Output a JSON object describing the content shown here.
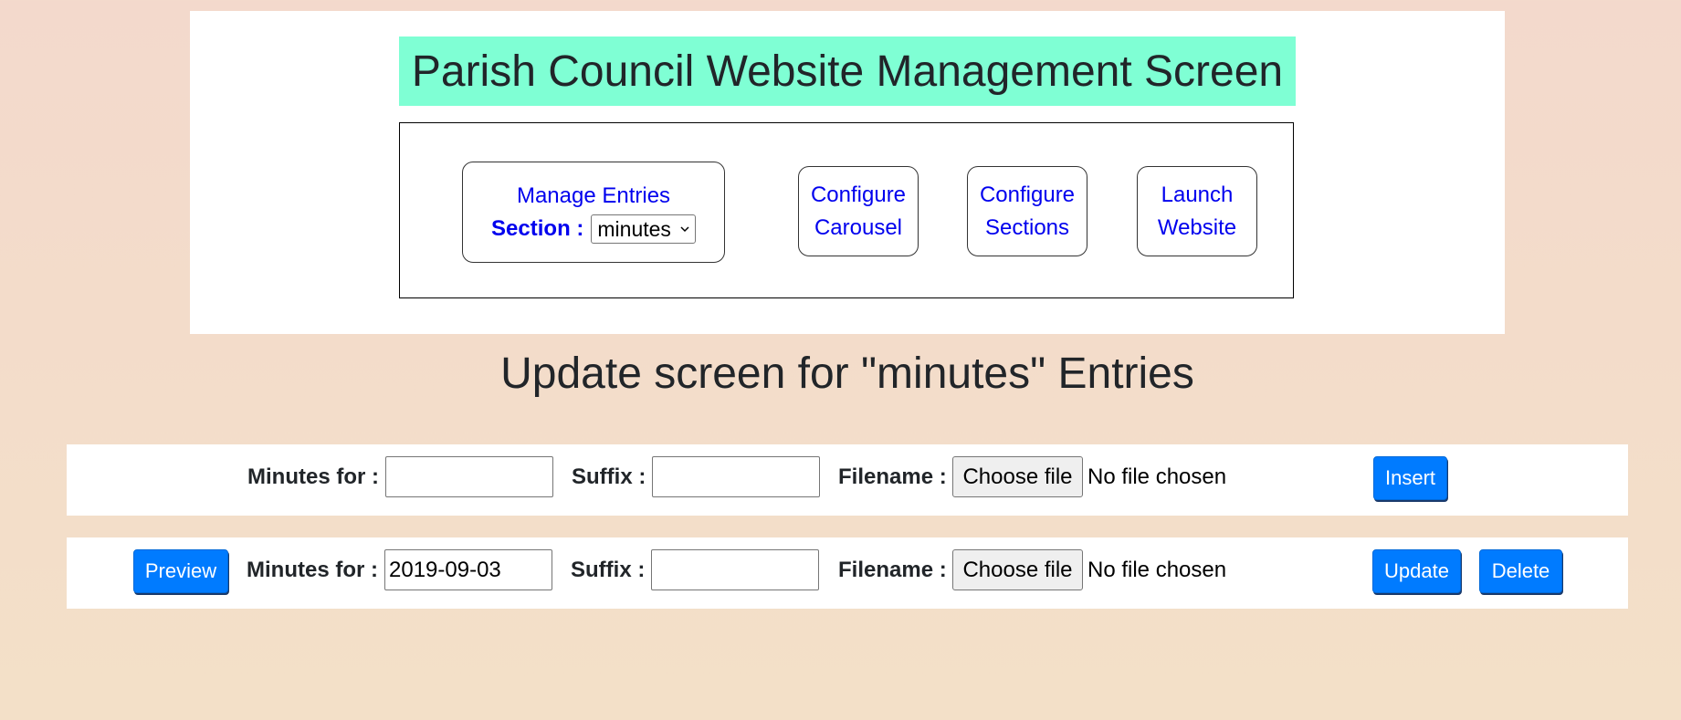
{
  "header": {
    "title": "Parish Council Website Management Screen",
    "nav": {
      "manage_entries": "Manage Entries",
      "section_label": "Section :",
      "section_selected": "minutes",
      "configure_carousel": [
        "Configure",
        "Carousel"
      ],
      "configure_sections": [
        "Configure",
        "Sections"
      ],
      "launch_website": [
        "Launch",
        "Website"
      ]
    }
  },
  "main": {
    "heading": "Update screen for \"minutes\" Entries",
    "insert_row": {
      "minutes_label": "Minutes for :",
      "minutes_value": "",
      "suffix_label": "Suffix :",
      "suffix_value": "",
      "filename_label": "Filename :",
      "file_button": "Choose file",
      "file_status": "No file chosen",
      "insert_button": "Insert"
    },
    "entries": [
      {
        "preview_button": "Preview",
        "minutes_label": "Minutes for :",
        "minutes_value": "2019-09-03",
        "suffix_label": "Suffix :",
        "suffix_value": "",
        "filename_label": "Filename :",
        "file_button": "Choose file",
        "file_status": "No file chosen",
        "update_button": "Update",
        "delete_button": "Delete"
      }
    ]
  },
  "colors": {
    "title_bg": "#7fffd4",
    "link": "#0000ee",
    "button_primary": "#007bff"
  }
}
